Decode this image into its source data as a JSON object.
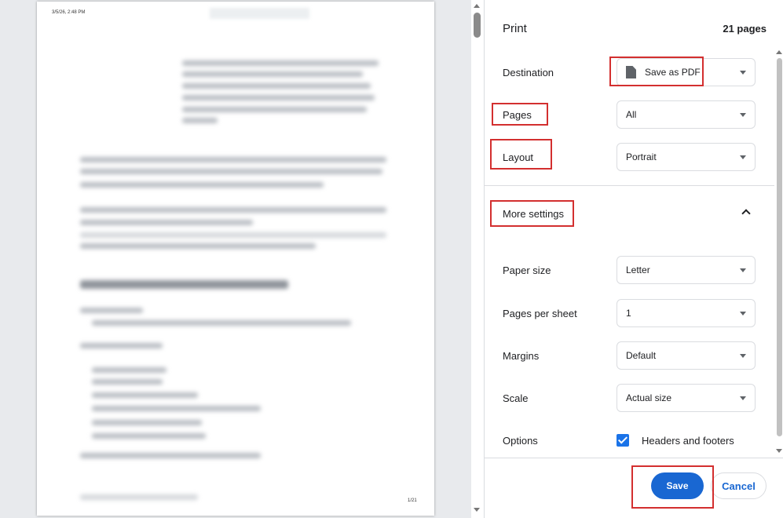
{
  "preview": {
    "header_date": "3/5/26, 2:48 PM",
    "footer_page": "1/21"
  },
  "panel": {
    "title": "Print",
    "page_count": "21 pages",
    "destination": {
      "label": "Destination",
      "value": "Save as PDF"
    },
    "pages": {
      "label": "Pages",
      "value": "All"
    },
    "layout": {
      "label": "Layout",
      "value": "Portrait"
    },
    "more_settings": {
      "label": "More settings",
      "icon": "chevron-up-icon"
    },
    "paper_size": {
      "label": "Paper size",
      "value": "Letter"
    },
    "pages_per_sheet": {
      "label": "Pages per sheet",
      "value": "1"
    },
    "margins": {
      "label": "Margins",
      "value": "Default"
    },
    "scale": {
      "label": "Scale",
      "value": "Actual size"
    },
    "options": {
      "label": "Options",
      "checkbox_label": "Headers and footers",
      "checked": true
    }
  },
  "footer": {
    "save_label": "Save",
    "cancel_label": "Cancel"
  },
  "colors": {
    "accent": "#1967d2",
    "highlight": "#d32f2f"
  }
}
